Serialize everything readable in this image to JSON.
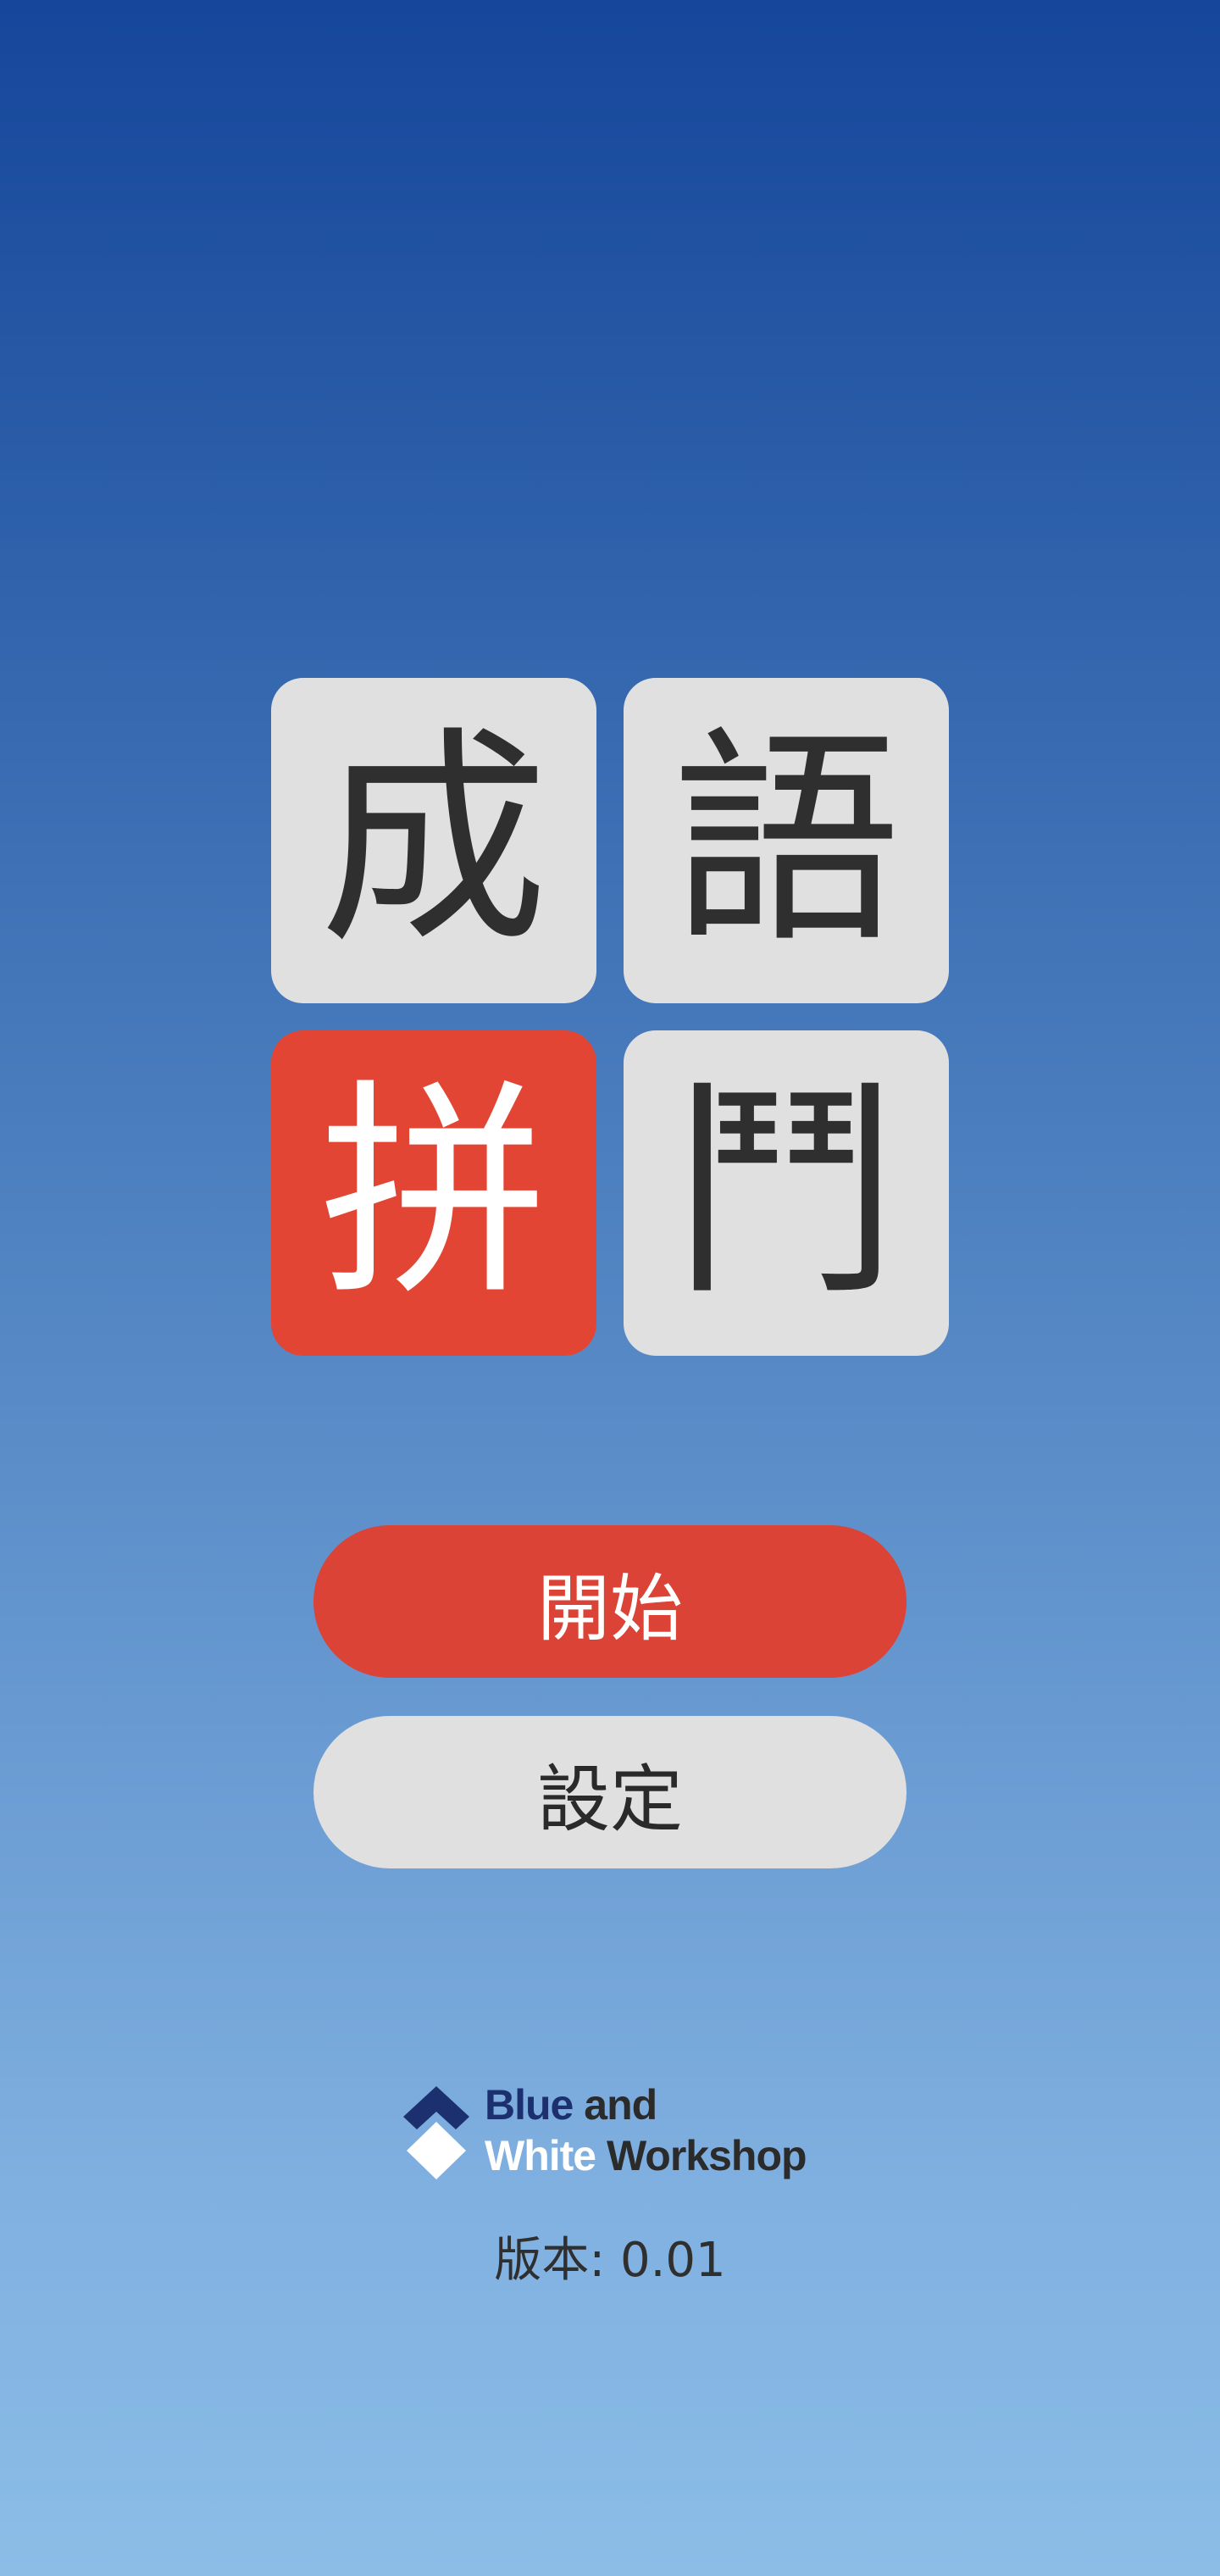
{
  "logo_tiles": [
    {
      "char": "成",
      "style": "light"
    },
    {
      "char": "語",
      "style": "light"
    },
    {
      "char": "拼",
      "style": "red"
    },
    {
      "char": "鬥",
      "style": "light"
    }
  ],
  "buttons": {
    "start_label": "開始",
    "settings_label": "設定"
  },
  "brand": {
    "word_blue": "Blue",
    "word_and": "and",
    "word_white": "White",
    "word_workshop": "Workshop"
  },
  "version": {
    "label": "版本:",
    "value": "0.01"
  },
  "colors": {
    "accent_red": "#e34535",
    "tile_light": "#e0e0e0",
    "brand_navy": "#1c2f6f",
    "background_top": "#15469b",
    "background_bottom": "#8bbde7"
  }
}
